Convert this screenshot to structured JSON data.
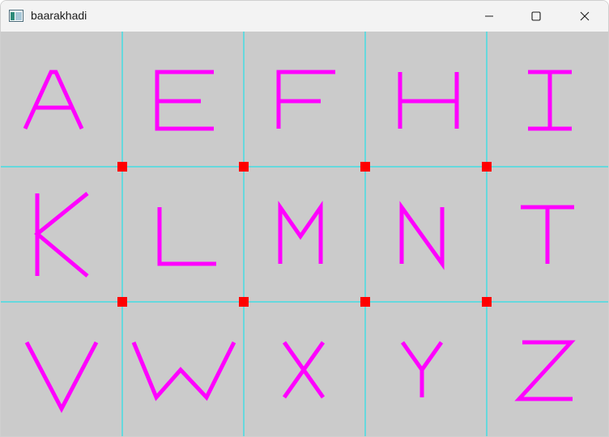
{
  "window": {
    "title": "baarakhadi"
  },
  "icons": {
    "app": "app-window-icon",
    "minimize": "minimize-icon",
    "maximize": "maximize-icon",
    "close": "close-icon"
  },
  "colors": {
    "canvas_bg": "#cbcbcb",
    "grid_line": "#00e5ef",
    "letter": "#ff00ff",
    "marker": "#ff0000"
  },
  "grid": {
    "columns": 5,
    "rows": 3
  },
  "letters": [
    [
      "A",
      "E",
      "F",
      "H",
      "I"
    ],
    [
      "K",
      "L",
      "M",
      "N",
      "T"
    ],
    [
      "V",
      "W",
      "X",
      "Y",
      "Z"
    ]
  ]
}
